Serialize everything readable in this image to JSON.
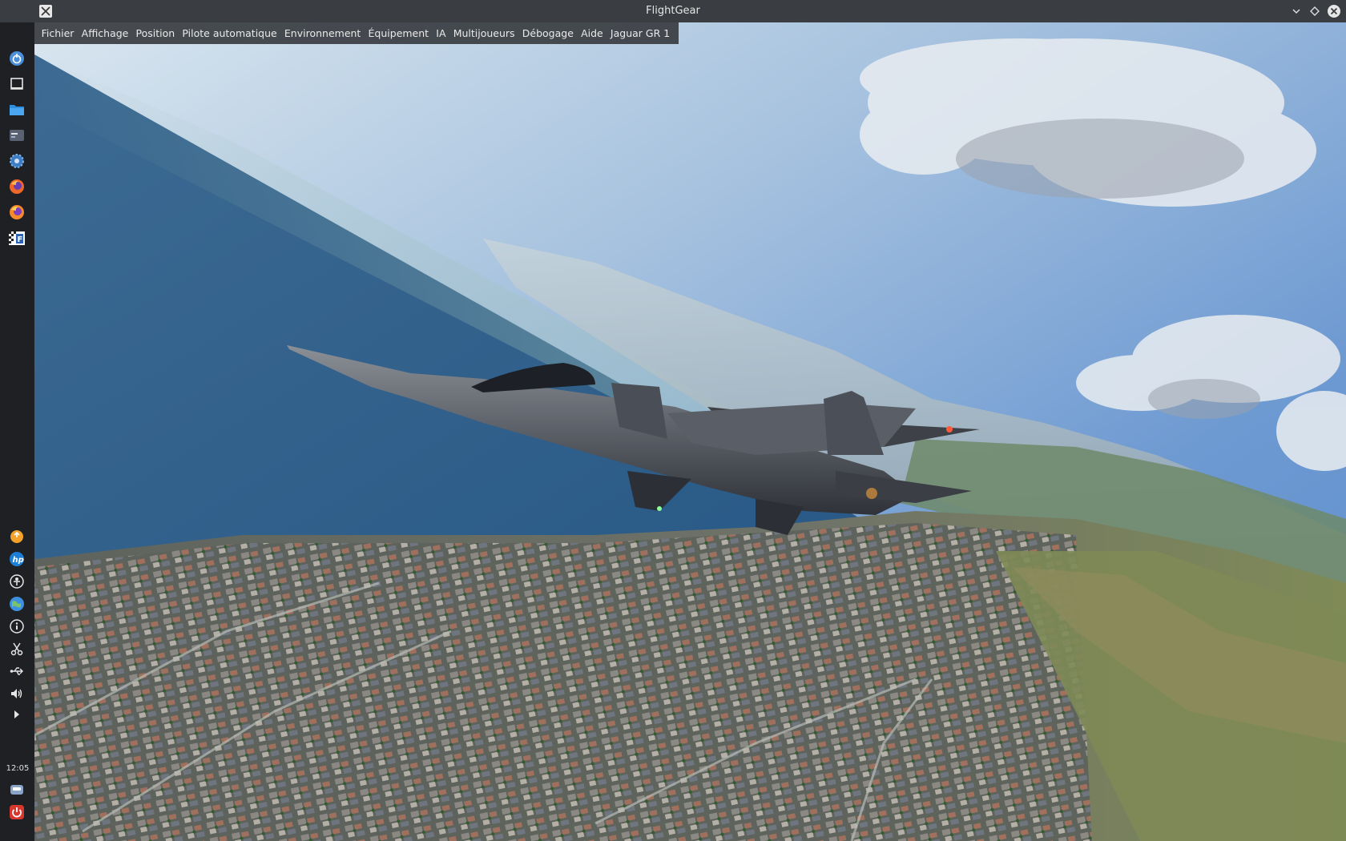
{
  "window": {
    "title": "FlightGear"
  },
  "menu": {
    "items": [
      "Fichier",
      "Affichage",
      "Position",
      "Pilote automatique",
      "Environnement",
      "Équipement",
      "IA",
      "Multijoueurs",
      "Débogage",
      "Aide",
      "Jaguar GR 1"
    ]
  },
  "dock": {
    "top_icons": [
      "menu-launcher-icon",
      "desktop-icon",
      "folder-icon",
      "window-manager-icon",
      "settings-gear-icon",
      "firefox-icon",
      "firefox-alt-icon",
      "flightgear-icon"
    ],
    "bottom_icons": [
      "update-icon",
      "hp-printer-icon",
      "accessibility-icon",
      "network-globe-icon",
      "info-icon",
      "scissors-icon",
      "usb-icon",
      "volume-icon",
      "expand-arrow-icon"
    ],
    "clock": "12:05",
    "tray_icons": [
      "storage-drive-icon",
      "power-icon"
    ]
  },
  "scene": {
    "aircraft": "jet-aircraft",
    "colors": {
      "sky": "#6b97d3",
      "sea": "#2f5d86",
      "city": "#6b6f68",
      "hills": "#7c8a55"
    }
  }
}
